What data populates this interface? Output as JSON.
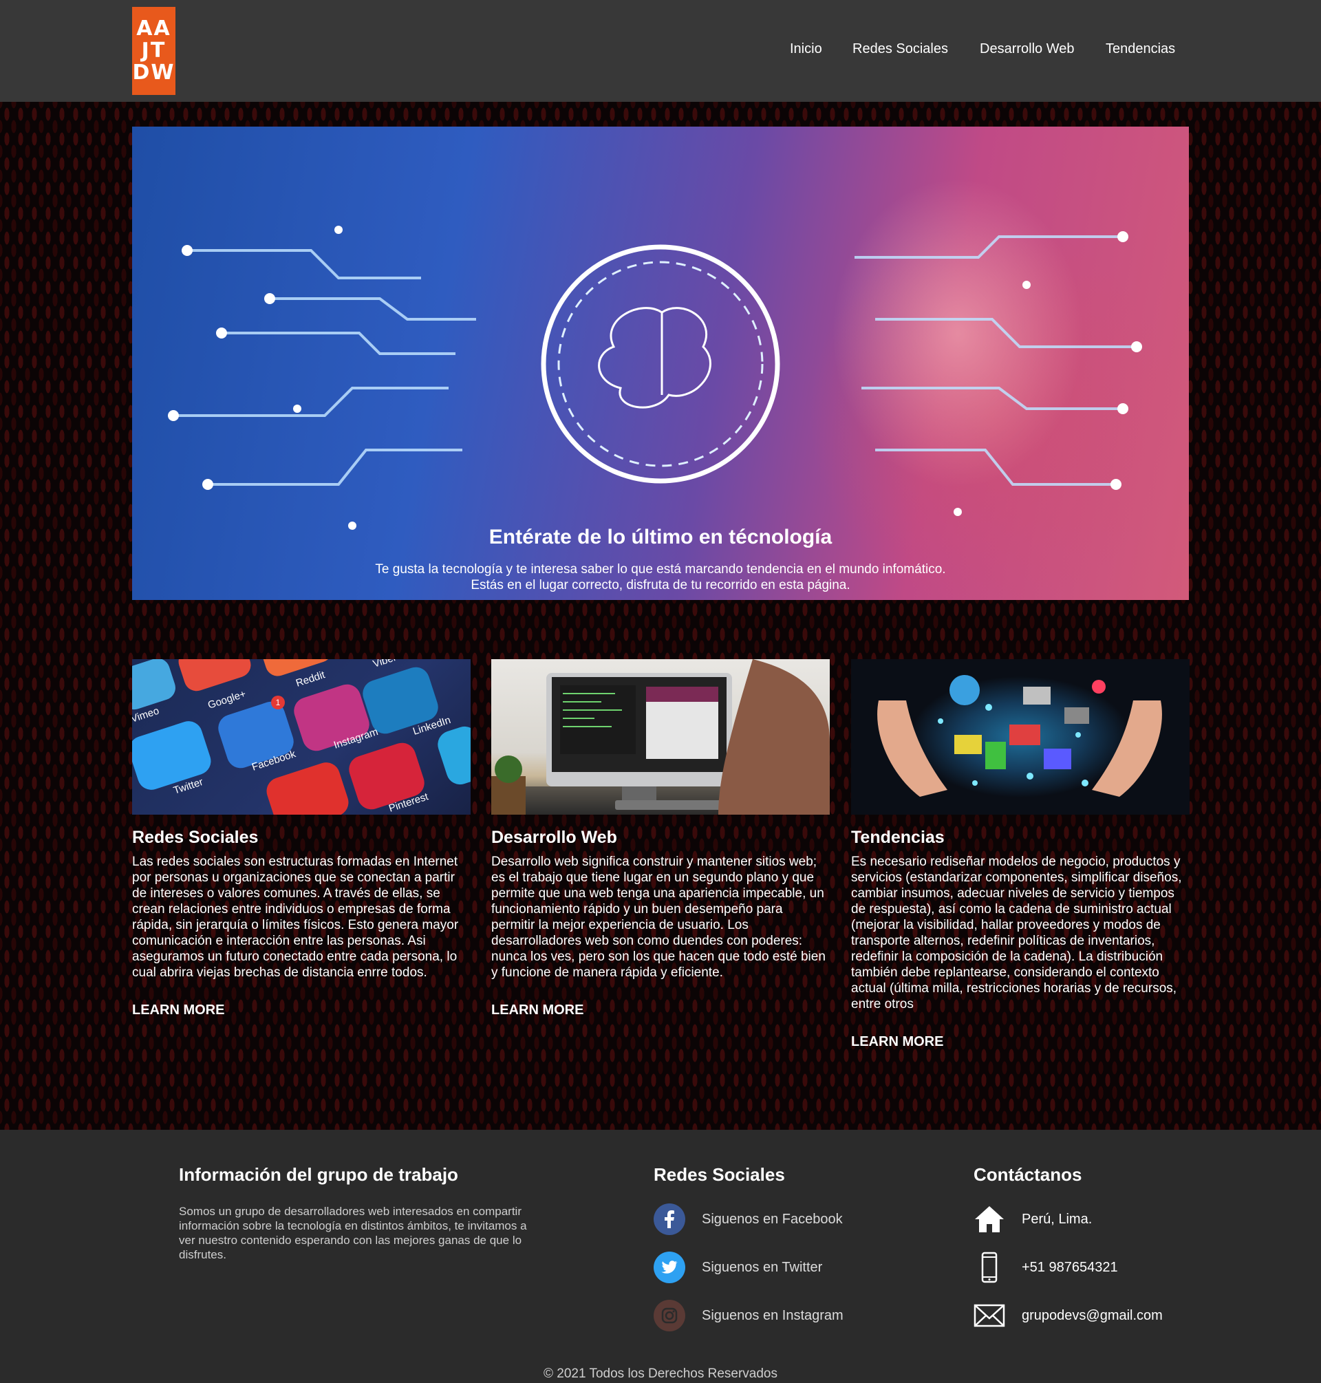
{
  "logo": {
    "lines": [
      "AA",
      "JT",
      "DW"
    ]
  },
  "nav": [
    {
      "label": "Inicio"
    },
    {
      "label": "Redes Sociales"
    },
    {
      "label": "Desarrollo Web"
    },
    {
      "label": "Tendencias"
    }
  ],
  "hero": {
    "title": "Entérate de lo último en técnología",
    "subtitle_line1": "Te gusta la tecnología y te interesa saber lo que está marcando tendencia en el mundo infomático.",
    "subtitle_line2": "Estás en el lugar correcto, disfruta de tu recorrido en esta página."
  },
  "cards": [
    {
      "title": "Redes Sociales",
      "text": "Las redes sociales son estructuras formadas en Internet por personas u organizaciones que se conectan a partir de intereses o valores comunes. A través de ellas, se crean relaciones entre individuos o empresas de forma rápida, sin jerarquía o límites físicos. Esto genera mayor comunicación e interacción entre las personas. Asi aseguramos un futuro conectado entre cada persona, lo cual abrira viejas brechas de distancia enrre todos.",
      "link": "LEARN MORE",
      "image_labels": [
        "Vimeo",
        "Google+",
        "Reddit",
        "Viber",
        "LinkedIn",
        "Instagram",
        "Facebook",
        "Twitter",
        "Pinterest",
        "1"
      ]
    },
    {
      "title": "Desarrollo Web",
      "text": "Desarrollo web significa construir y mantener sitios web; es el trabajo que tiene lugar en un segundo plano y que permite que una web tenga una apariencia impecable, un funcionamiento rápido y un buen desempeño para permitir la mejor experiencia de usuario. Los desarrolladores web son como duendes con poderes: nunca los ves, pero son los que hacen que todo esté bien y funcione de manera rápida y eficiente.",
      "link": "LEARN MORE"
    },
    {
      "title": "Tendencias",
      "text": "Es necesario rediseñar modelos de negocio, productos y servicios (estandarizar componentes, simplificar diseños, cambiar insumos, adecuar niveles de servicio y tiempos de respuesta), así como la cadena de suministro actual (mejorar la visibilidad, hallar proveedores y modos de transporte alternos, redefinir políticas de inventarios, redefinir la composición de la cadena). La distribución también debe replantearse, considerando el contexto actual (última milla, restricciones horarias y de recursos, entre otros",
      "link": "LEARN MORE"
    }
  ],
  "footer": {
    "info_title": "Información del grupo de trabajo",
    "info_text": "Somos un grupo de desarrolladores web interesados en compartir información sobre la tecnología en distintos ámbitos, te invitamos a ver nuestro contenido esperando con las mejores ganas de que lo disfrutes.",
    "social_title": "Redes Sociales",
    "social": [
      {
        "label": "Siguenos en Facebook",
        "icon": "facebook-icon",
        "color": "#3b5998"
      },
      {
        "label": "Siguenos en Twitter",
        "icon": "twitter-icon",
        "color": "#2ea1f2"
      },
      {
        "label": "Siguenos en Instagram",
        "icon": "instagram-icon",
        "color": "#5a3a35"
      }
    ],
    "contact_title": "Contáctanos",
    "contact": [
      {
        "label": "Perú, Lima.",
        "icon": "home-icon"
      },
      {
        "label": "+51 987654321",
        "icon": "phone-icon"
      },
      {
        "label": "grupodevs@gmail.com",
        "icon": "mail-icon"
      }
    ],
    "copyright": "© 2021 Todos los Derechos Reservados"
  },
  "colors": {
    "accent": "#e8591c",
    "header": "#383838",
    "footer": "#2b2b2b"
  }
}
